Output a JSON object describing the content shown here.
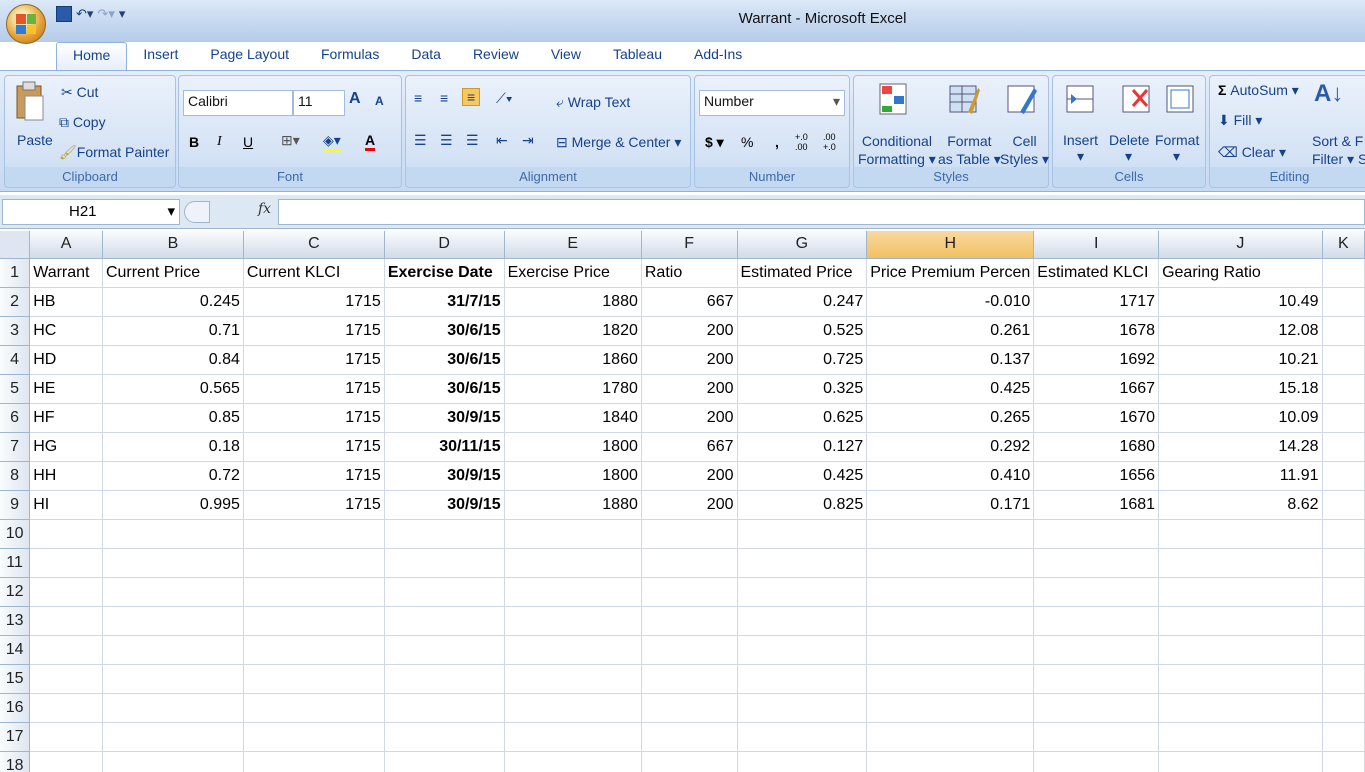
{
  "window": {
    "title": "Warrant - Microsoft Excel"
  },
  "tabs": [
    "Home",
    "Insert",
    "Page Layout",
    "Formulas",
    "Data",
    "Review",
    "View",
    "Tableau",
    "Add-Ins"
  ],
  "clipboard": {
    "paste": "Paste",
    "cut": "Cut",
    "copy": "Copy",
    "format_painter": "Format Painter",
    "label": "Clipboard"
  },
  "font": {
    "name": "Calibri",
    "size": "11",
    "bold": "B",
    "italic": "I",
    "underline": "U",
    "grow": "A",
    "shrink": "A",
    "color_letter": "A",
    "label": "Font"
  },
  "alignment": {
    "wrap": "Wrap Text",
    "merge": "Merge & Center",
    "label": "Alignment"
  },
  "number": {
    "format": "Number",
    "currency": "$",
    "percent": "%",
    "comma": ",",
    "inc": "+.0 .00",
    "dec": ".00 +.0",
    "label": "Number"
  },
  "styles": {
    "conditional": "Conditional",
    "conditional2": "Formatting",
    "format_table": "Format",
    "format_table2": "as Table",
    "cell_styles": "Cell",
    "cell_styles2": "Styles",
    "label": "Styles"
  },
  "cells": {
    "insert": "Insert",
    "delete": "Delete",
    "format": "Format",
    "label": "Cells"
  },
  "editing": {
    "autosum": "AutoSum",
    "fill": "Fill",
    "clear": "Clear",
    "sort": "Sort &",
    "filter": "Filter",
    "label": "Editing",
    "cut1": "F",
    "cut2": "S"
  },
  "formula_bar": {
    "name_box": "H21",
    "fx": "fx",
    "value": ""
  },
  "sheet": {
    "columns": [
      "A",
      "B",
      "C",
      "D",
      "E",
      "F",
      "G",
      "H",
      "I",
      "J",
      "K"
    ],
    "header_row": [
      "Warrant",
      "Current Price",
      "Current KLCI",
      "Exercise Date",
      "Exercise Price",
      "Ratio",
      "Estimated Price",
      "Price Premium Percen",
      "Estimated KLCI",
      "Gearing Ratio",
      ""
    ],
    "rows": [
      [
        "HB",
        "0.245",
        "1715",
        "31/7/15",
        "1880",
        "667",
        "0.247",
        "-0.010",
        "1717",
        "10.49"
      ],
      [
        "HC",
        "0.71",
        "1715",
        "30/6/15",
        "1820",
        "200",
        "0.525",
        "0.261",
        "1678",
        "12.08"
      ],
      [
        "HD",
        "0.84",
        "1715",
        "30/6/15",
        "1860",
        "200",
        "0.725",
        "0.137",
        "1692",
        "10.21"
      ],
      [
        "HE",
        "0.565",
        "1715",
        "30/6/15",
        "1780",
        "200",
        "0.325",
        "0.425",
        "1667",
        "15.18"
      ],
      [
        "HF",
        "0.85",
        "1715",
        "30/9/15",
        "1840",
        "200",
        "0.625",
        "0.265",
        "1670",
        "10.09"
      ],
      [
        "HG",
        "0.18",
        "1715",
        "30/11/15",
        "1800",
        "667",
        "0.127",
        "0.292",
        "1680",
        "14.28"
      ],
      [
        "HH",
        "0.72",
        "1715",
        "30/9/15",
        "1800",
        "200",
        "0.425",
        "0.410",
        "1656",
        "11.91"
      ],
      [
        "HI",
        "0.995",
        "1715",
        "30/9/15",
        "1880",
        "200",
        "0.825",
        "0.171",
        "1681",
        "8.62"
      ]
    ],
    "row_numbers": [
      "1",
      "2",
      "3",
      "4",
      "5",
      "6",
      "7",
      "8",
      "9",
      "10",
      "11",
      "12",
      "13",
      "14",
      "15",
      "16",
      "17",
      "18"
    ]
  }
}
